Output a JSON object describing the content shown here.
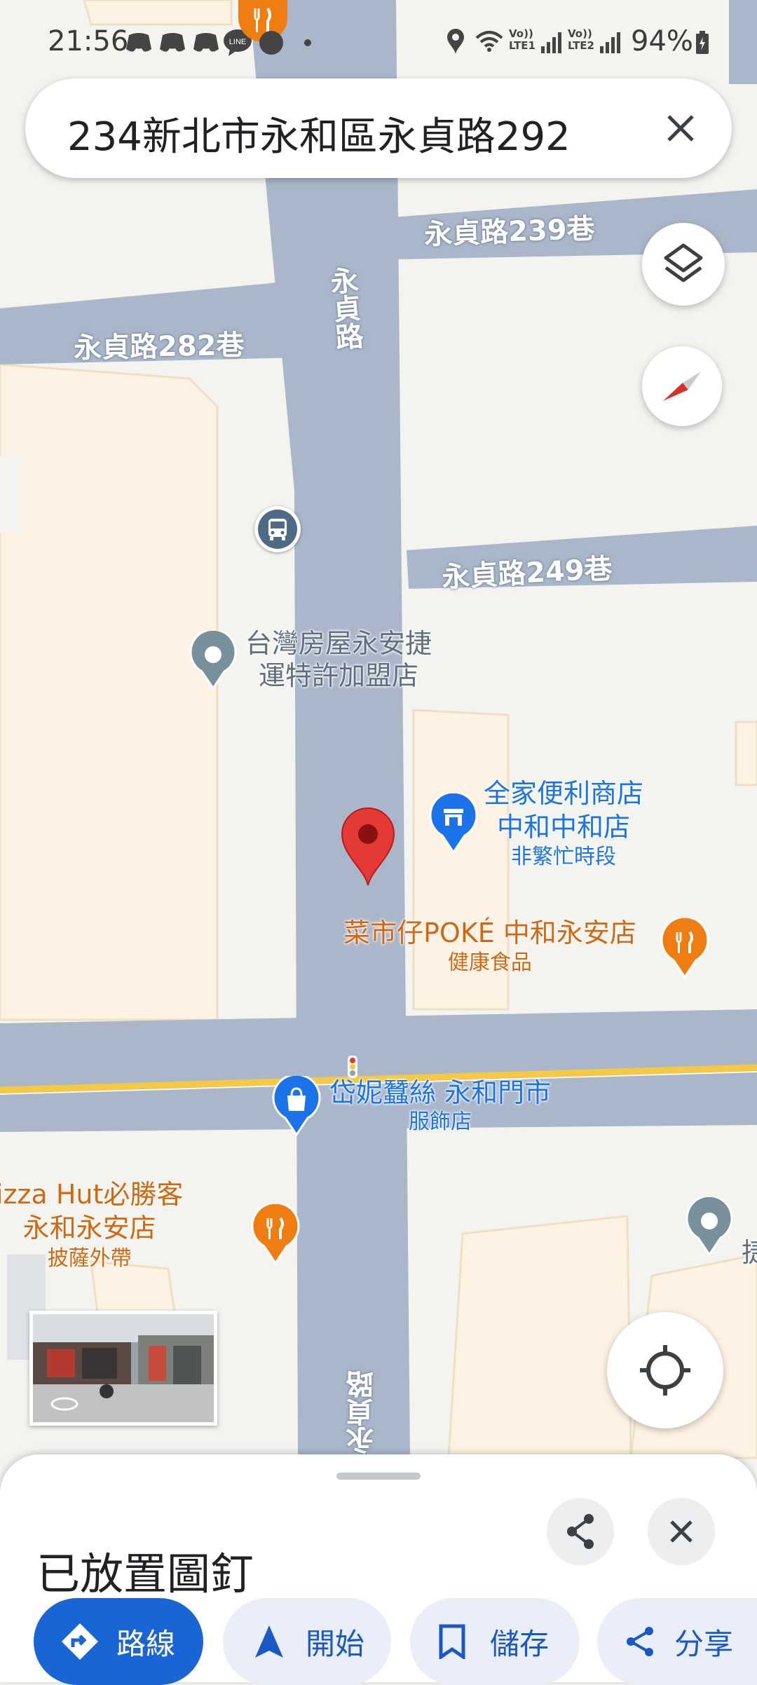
{
  "status_bar": {
    "time": "21:56",
    "battery": "94%",
    "lte1": "LTE1",
    "lte2": "LTE2",
    "volte": "Vo))"
  },
  "search": {
    "value": "234新北市永和區永貞路292"
  },
  "map": {
    "road_labels": {
      "lane_239": "永貞路239巷",
      "lane_282": "永貞路282巷",
      "main_road": "永貞路",
      "lane_249": "永貞路249巷",
      "bottom_road": "永貞路"
    },
    "pois": {
      "realty_line1": "台灣房屋永安捷",
      "realty_line2": "運特許加盟店",
      "familymart_line1": "全家便利商店",
      "familymart_line2": "中和中和店",
      "familymart_sub": "非繁忙時段",
      "poke_name": "菜市仔POKÉ 中和永安店",
      "poke_sub": "健康食品",
      "shop_name": "岱妮蠶絲 永和門市",
      "shop_sub": "服飾店",
      "pizza_line1": "izza Hut必勝客",
      "pizza_line2": "永和永安店",
      "pizza_sub": "披薩外帶",
      "edge_label": "捷"
    },
    "colors": {
      "road": "#aab7cb",
      "block": "#fdf2e3",
      "block_border": "#f0dfc2",
      "background": "#f3f3f0",
      "pin": "#e53935",
      "poi_blue": "#1a73e8",
      "poi_orange": "#ef7d12",
      "poi_gray": "#78909c",
      "highway_yellow": "#f7c940"
    }
  },
  "bottom_sheet": {
    "title": "已放置圖釘",
    "actions": {
      "directions": "路線",
      "start": "開始",
      "save": "儲存",
      "share": "分享"
    }
  },
  "icons": [
    "signal-icon",
    "wifi-icon",
    "location-icon",
    "battery-icon",
    "discord-icon",
    "line-icon",
    "restaurant-icon",
    "close-icon",
    "layers-icon",
    "compass-icon",
    "bus-icon",
    "pin-icon",
    "store-icon",
    "shopping-bag-icon",
    "traffic-light-icon",
    "my-location-icon",
    "share-icon",
    "directions-icon",
    "navigation-arrow-icon",
    "bookmark-icon"
  ]
}
